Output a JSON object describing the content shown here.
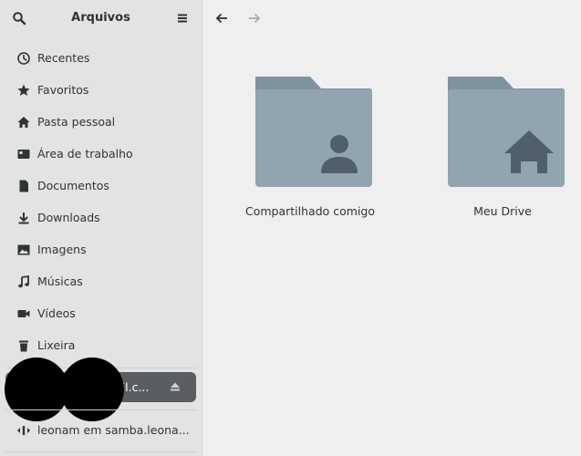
{
  "sidebar": {
    "title": "Arquivos",
    "items": [
      {
        "label": "Recentes",
        "icon": "clock-icon"
      },
      {
        "label": "Favoritos",
        "icon": "star-icon"
      },
      {
        "label": "Pasta pessoal",
        "icon": "home-icon"
      },
      {
        "label": "Área de trabalho",
        "icon": "desktop-icon"
      },
      {
        "label": "Documentos",
        "icon": "document-icon"
      },
      {
        "label": "Downloads",
        "icon": "download-icon"
      },
      {
        "label": "Imagens",
        "icon": "image-icon"
      },
      {
        "label": "Músicas",
        "icon": "music-icon"
      },
      {
        "label": "Vídeos",
        "icon": "video-icon"
      },
      {
        "label": "Lixeira",
        "icon": "trash-icon"
      }
    ],
    "mounted_drive": {
      "label": "ail.c...",
      "icon": "eject-icon"
    },
    "network": {
      "label": "leonam em samba.leona...",
      "icon": "network-icon"
    }
  },
  "main": {
    "folders": [
      {
        "label": "Compartilhado comigo",
        "icon": "shared-folder-icon"
      },
      {
        "label": "Meu Drive",
        "icon": "home-folder-icon"
      }
    ]
  },
  "colors": {
    "sidebar_bg": "#e3e3e3",
    "main_bg": "#efefef",
    "folder_back": "#7f939e",
    "folder_front": "#92a4ad",
    "folder_glyph": "#4f606a",
    "drive_row_bg": "#5b5e60"
  }
}
